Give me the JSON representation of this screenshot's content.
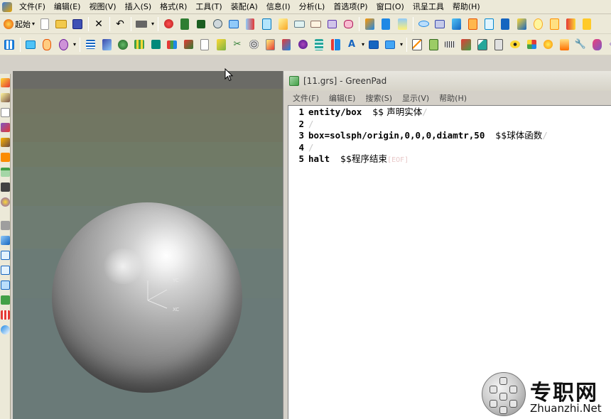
{
  "menubar": {
    "items": [
      {
        "label": "文件(F)"
      },
      {
        "label": "编辑(E)"
      },
      {
        "label": "视图(V)"
      },
      {
        "label": "插入(S)"
      },
      {
        "label": "格式(R)"
      },
      {
        "label": "工具(T)"
      },
      {
        "label": "装配(A)"
      },
      {
        "label": "信息(I)"
      },
      {
        "label": "分析(L)"
      },
      {
        "label": "首选项(P)"
      },
      {
        "label": "窗口(O)"
      },
      {
        "label": "讯呈工具"
      },
      {
        "label": "帮助(H)"
      }
    ]
  },
  "toolbar": {
    "start_label": "起始"
  },
  "viewport": {
    "axis_labels": {
      "yc": "YC",
      "xc": "XC"
    }
  },
  "greenpad": {
    "title": "[11.grs] - GreenPad",
    "menu": [
      {
        "label": "文件(F)"
      },
      {
        "label": "编辑(E)"
      },
      {
        "label": "搜索(S)"
      },
      {
        "label": "显示(V)"
      },
      {
        "label": "帮助(H)"
      }
    ],
    "lines": [
      {
        "no": "1",
        "code": "entity/box  ",
        "comment": "$$ 声明实体",
        "eol": "/"
      },
      {
        "no": "2",
        "code": "",
        "comment": "",
        "eol": "/"
      },
      {
        "no": "3",
        "code": "box=solsph/origin,0,0,0,diamtr,50  ",
        "comment": "$$球体函数",
        "eol": "/"
      },
      {
        "no": "4",
        "code": "",
        "comment": "",
        "eol": "/"
      },
      {
        "no": "5",
        "code": "halt  ",
        "comment": "$$程序结束",
        "eol": "[EOF]"
      }
    ]
  },
  "watermark": {
    "cn": "专职网",
    "en": "Zhuanzhi.Net"
  },
  "colors": {
    "menubar_bg": "#ece9d8",
    "viewport_bg": "#6b7b76",
    "editor_bg": "#ffffff"
  }
}
